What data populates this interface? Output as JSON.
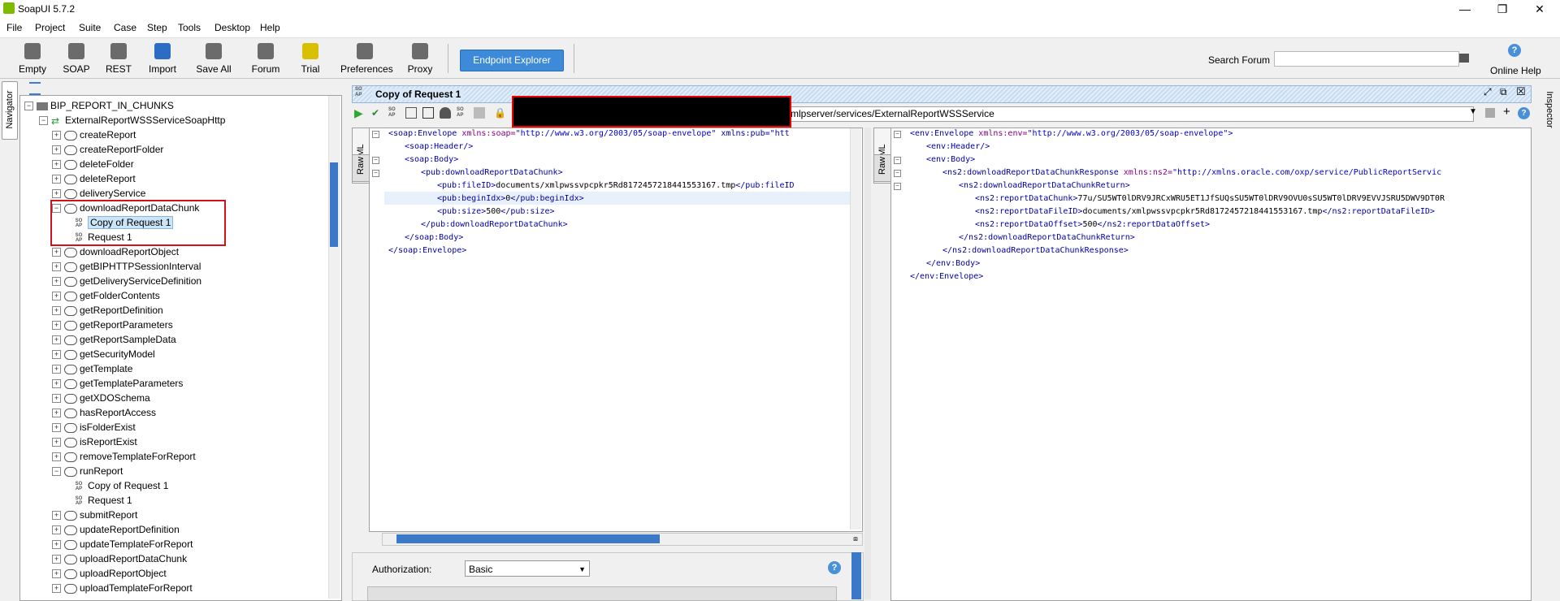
{
  "window": {
    "title": "SoapUI 5.7.2",
    "minimize": "—",
    "maximize": "❐",
    "close": "✕"
  },
  "menu": [
    "File",
    "Project",
    "Suite",
    "Case",
    "Step",
    "Tools",
    "Desktop",
    "Help"
  ],
  "toolbar": {
    "buttons": [
      "Empty",
      "SOAP",
      "REST",
      "Import",
      "Save All",
      "Forum",
      "Trial",
      "Preferences",
      "Proxy"
    ],
    "endpoint_explorer": "Endpoint Explorer",
    "search_label": "Search Forum",
    "search_placeholder": "",
    "online_help": "Online Help",
    "help_glyph": "?"
  },
  "side_tabs": {
    "navigator": "Navigator",
    "inspector": "Inspector"
  },
  "tree": {
    "project": "BIP_REPORT_IN_CHUNKS",
    "interface": "ExternalReportWSSServiceSoapHttp",
    "operations": [
      "createReport",
      "createReportFolder",
      "deleteFolder",
      "deleteReport",
      "deliveryService",
      "downloadReportDataChunk",
      "downloadReportObject",
      "getBIPHTTPSessionInterval",
      "getDeliveryServiceDefinition",
      "getFolderContents",
      "getReportDefinition",
      "getReportParameters",
      "getReportSampleData",
      "getSecurityModel",
      "getTemplate",
      "getTemplateParameters",
      "getXDOSchema",
      "hasReportAccess",
      "isFolderExist",
      "isReportExist",
      "removeTemplateForReport",
      "runReport",
      "submitReport",
      "updateReportDefinition",
      "updateTemplateForReport",
      "uploadReportDataChunk",
      "uploadReportObject",
      "uploadTemplateForReport"
    ],
    "download_requests": [
      "Copy of Request 1",
      "Request 1"
    ],
    "run_requests": [
      "Copy of Request 1",
      "Request 1"
    ],
    "soap_icon": "SO AP"
  },
  "editor": {
    "title": "Copy of Request 1",
    "endpoint": "xmlpserver/services/ExternalReportWSSService",
    "left_tabs": [
      "XML",
      "Raw"
    ],
    "right_tabs": [
      "XML",
      "Raw"
    ],
    "request_lines": [
      [
        "<soap:Envelope",
        " xmlns:soap=",
        "\"http://www.w3.org/2003/05/soap-envelope\"",
        " xmlns:pub=\"htt"
      ],
      [
        "<soap:Header/>",
        "",
        "",
        ""
      ],
      [
        "<soap:Body>",
        "",
        "",
        ""
      ],
      [
        "<pub:downloadReportDataChunk>",
        "",
        "",
        ""
      ],
      [
        "<pub:fileID>",
        "documents/xmlpwssvpcpkr5Rd8172457218441553167.tmp",
        "</pub:fileID",
        ""
      ],
      [
        "<pub:beginIdx>",
        "0",
        "</pub:beginIdx>",
        ""
      ],
      [
        "<pub:size>",
        "500",
        "</pub:size>",
        ""
      ],
      [
        "</pub:downloadReportDataChunk>",
        "",
        "",
        ""
      ],
      [
        "</soap:Body>",
        "",
        "",
        ""
      ],
      [
        "</soap:Envelope>",
        "",
        "",
        ""
      ]
    ],
    "response_lines": [
      [
        "<env:Envelope",
        " xmlns:env=",
        "\"http://www.w3.org/2003/05/soap-envelope\">",
        ""
      ],
      [
        "<env:Header/>",
        "",
        "",
        ""
      ],
      [
        "<env:Body>",
        "",
        "",
        ""
      ],
      [
        "<ns2:downloadReportDataChunkResponse",
        " xmlns:ns2=",
        "\"http://xmlns.oracle.com/oxp/service/PublicReportServic",
        ""
      ],
      [
        "<ns2:downloadReportDataChunkReturn>",
        "",
        "",
        ""
      ],
      [
        "<ns2:reportDataChunk>",
        "77u/SU5WT0lDRV9JRCxWRU5ET1JfSUQsSU5WT0lDRV9OVU0sSU5WT0lDRV9EVVJSRU5DWV9DT0R",
        "",
        ""
      ],
      [
        "<ns2:reportDataFileID>",
        "documents/xmlpwssvpcpkr5Rd8172457218441553167.tmp",
        "</ns2:reportDataFileID>",
        ""
      ],
      [
        "<ns2:reportDataOffset>",
        "500",
        "</ns2:reportDataOffset>",
        ""
      ],
      [
        "</ns2:downloadReportDataChunkReturn>",
        "",
        "",
        ""
      ],
      [
        "</ns2:downloadReportDataChunkResponse>",
        "",
        "",
        ""
      ],
      [
        "</env:Body>",
        "",
        "",
        ""
      ],
      [
        "</env:Envelope>",
        "",
        "",
        ""
      ]
    ]
  },
  "auth": {
    "label": "Authorization:",
    "value": "Basic",
    "help_glyph": "?"
  },
  "colors": {
    "accent": "#3d8ad8",
    "highlight_border": "#d1111b",
    "xml_tag": "#0000aa",
    "xml_attr": "#8b008b",
    "xml_value": "#0000d0"
  }
}
